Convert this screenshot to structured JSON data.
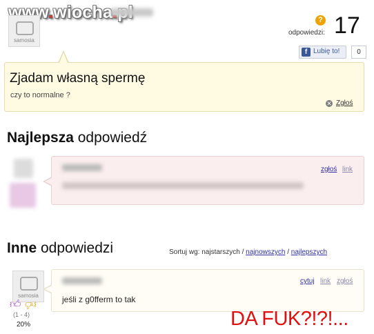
{
  "watermark": {
    "site": "www",
    "dot": ".",
    "name": "wiocha",
    "dot2": ".",
    "tld": "pl"
  },
  "question": {
    "avatar_label": "samosia",
    "answers_label": "odpowiedzi:",
    "answers_count": "17",
    "like_label": "Lubię to!",
    "like_count": "0",
    "title": "Zjadam własną spermę",
    "subtitle": "czy to normalne ?",
    "report_label": "Zgłoś"
  },
  "best": {
    "heading_bold": "Najlepsza",
    "heading_rest": " odpowiedź",
    "report_link": "zgłoś",
    "link_label": "link"
  },
  "others": {
    "heading_bold": "Inne",
    "heading_rest": " odpowiedzi",
    "sort_prefix": "Sortuj wg: najstarszych /",
    "sort_newest": "najnowszych",
    "sort_sep": "/",
    "sort_best": "najlepszych",
    "avatar_label": "samosia",
    "quote_label": "cytuj",
    "link_label": "link",
    "report_label": "zgłoś",
    "answer_text": "jeśli z g0fferm to tak",
    "vote_range": "(1 - 4)",
    "vote_percent": "20%"
  },
  "overlay_text": "DA FUK?!?!..."
}
